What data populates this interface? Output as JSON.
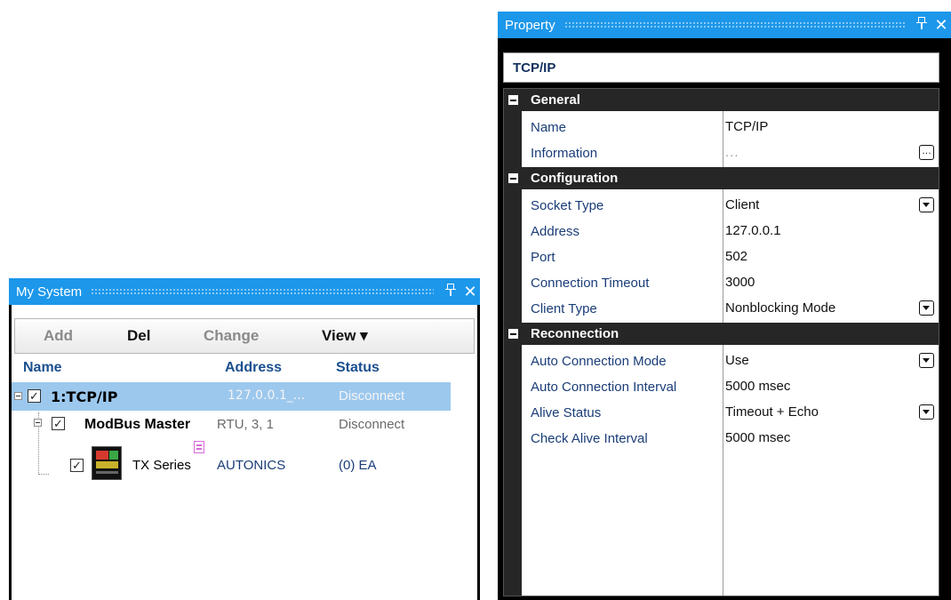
{
  "my_system": {
    "title": "My System",
    "toolbar": {
      "add": "Add",
      "del": "Del",
      "change": "Change",
      "view": "View ▾"
    },
    "columns": {
      "name": "Name",
      "address": "Address",
      "status": "Status"
    },
    "rows": [
      {
        "name": "1:TCP/IP",
        "address": "127.0.0.1_...",
        "status": "Disconnect",
        "checked": true,
        "selected": true
      },
      {
        "name": "ModBus Master",
        "address": "RTU, 3, 1",
        "status": "Disconnect",
        "checked": true
      },
      {
        "name": "TX Series",
        "address": "AUTONICS",
        "status": "(0) EA",
        "checked": true
      }
    ]
  },
  "property": {
    "title": "Property",
    "object_name": "TCP/IP",
    "categories": [
      {
        "label": "General",
        "props": [
          {
            "name": "Name",
            "value": "TCP/IP"
          },
          {
            "name": "Information",
            "value": "..."
          }
        ]
      },
      {
        "label": "Configuration",
        "props": [
          {
            "name": "Socket Type",
            "value": "Client"
          },
          {
            "name": "Address",
            "value": "127.0.0.1"
          },
          {
            "name": "Port",
            "value": "502"
          },
          {
            "name": "Connection Timeout",
            "value": "3000"
          },
          {
            "name": "Client Type",
            "value": "Nonblocking Mode"
          }
        ]
      },
      {
        "label": "Reconnection",
        "props": [
          {
            "name": "Auto Connection Mode",
            "value": "Use"
          },
          {
            "name": "Auto Connection Interval",
            "value": "5000 msec"
          },
          {
            "name": "Alive Status",
            "value": "Timeout + Echo"
          },
          {
            "name": "Check Alive Interval",
            "value": "5000 msec"
          }
        ]
      }
    ]
  },
  "icons": {
    "pin": "pin-icon",
    "close": "close-icon",
    "ellipsis": "ellipsis-button",
    "dropdown": "dropdown-arrow-icon"
  },
  "colors": {
    "titlebar": "#1c97ea",
    "selection": "#9cc8ee",
    "category_bg": "#262626",
    "header_text": "#1a4f8f"
  }
}
